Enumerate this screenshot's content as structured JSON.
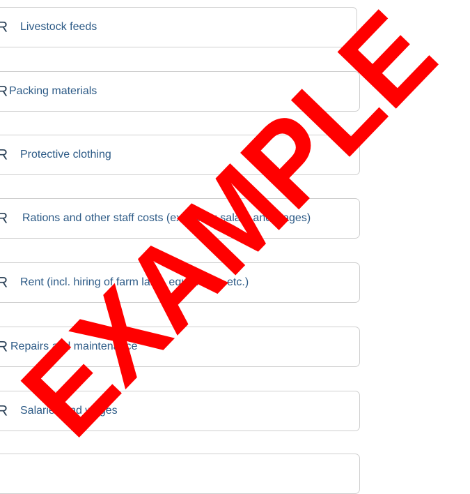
{
  "currency_symbol": "R",
  "fields": [
    {
      "label": "Livestock feeds"
    },
    {
      "label": "Packing materials"
    },
    {
      "label": "Protective clothing"
    },
    {
      "label": "Rations and other staff costs (excluding salary and wages)"
    },
    {
      "label": "Rent (incl. hiring of farm land, equipment, etc.)"
    },
    {
      "label": "Repairs and maintenance"
    },
    {
      "label": "Salaries and wages"
    },
    {
      "label": ""
    }
  ],
  "watermark": {
    "text": "EXAMPLE",
    "color": "#ff0000"
  }
}
